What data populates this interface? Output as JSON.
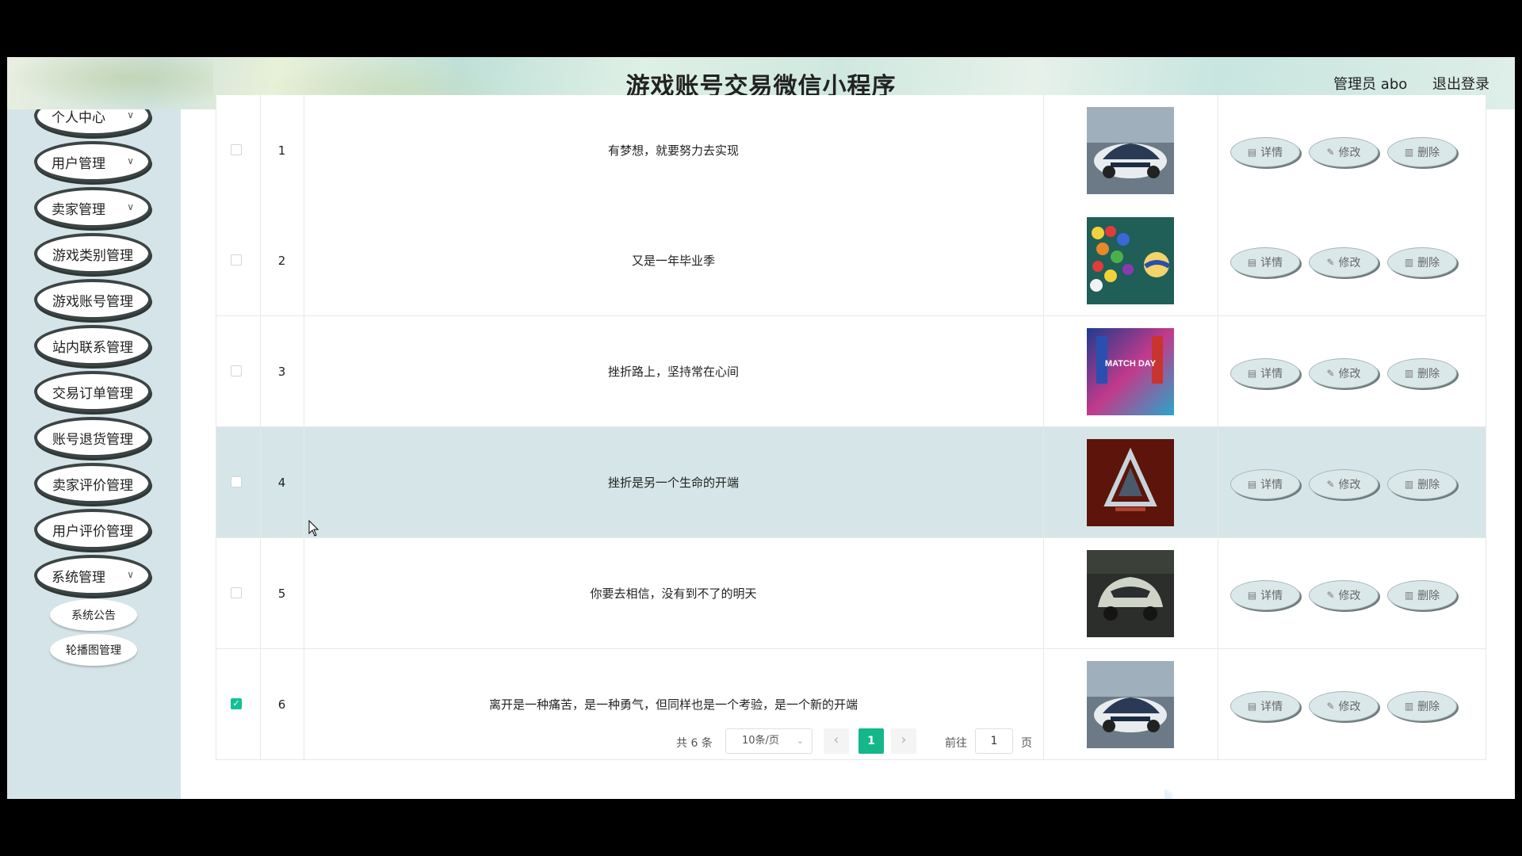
{
  "header": {
    "title": "游戏账号交易微信小程序",
    "user": "管理员 abo",
    "logout": "退出登录"
  },
  "sidebar": {
    "items": [
      {
        "label": "个人中心",
        "has_sub": true
      },
      {
        "label": "用户管理",
        "has_sub": true
      },
      {
        "label": "卖家管理",
        "has_sub": true
      },
      {
        "label": "游戏类别管理",
        "has_sub": false
      },
      {
        "label": "游戏账号管理",
        "has_sub": false
      },
      {
        "label": "站内联系管理",
        "has_sub": false
      },
      {
        "label": "交易订单管理",
        "has_sub": false
      },
      {
        "label": "账号退货管理",
        "has_sub": false
      },
      {
        "label": "卖家评价管理",
        "has_sub": false
      },
      {
        "label": "用户评价管理",
        "has_sub": false
      },
      {
        "label": "系统管理",
        "has_sub": true
      }
    ],
    "subitems": [
      {
        "label": "系统公告"
      },
      {
        "label": "轮播图管理"
      }
    ]
  },
  "table": {
    "rows": [
      {
        "index": "1",
        "text": "有梦想，就要努力去实现",
        "checked": false,
        "highlight": false,
        "thumb": "car-police"
      },
      {
        "index": "2",
        "text": "又是一年毕业季",
        "checked": false,
        "highlight": false,
        "thumb": "billiard-balls"
      },
      {
        "index": "3",
        "text": "挫折路上，坚持常在心间",
        "checked": false,
        "highlight": false,
        "thumb": "match-day-poster"
      },
      {
        "index": "4",
        "text": "挫折是另一个生命的开端",
        "checked": false,
        "highlight": true,
        "thumb": "red-logo"
      },
      {
        "index": "5",
        "text": "你要去相信，没有到不了的明天",
        "checked": false,
        "highlight": false,
        "thumb": "car-silver"
      },
      {
        "index": "6",
        "text": "离开是一种痛苦，是一种勇气，但同样也是一个考验，是一个新的开端",
        "checked": true,
        "highlight": false,
        "thumb": "car-police"
      }
    ],
    "actions": {
      "detail": "详情",
      "edit": "修改",
      "delete": "删除"
    },
    "thumb_text": {
      "match_day": "MATCH DAY"
    }
  },
  "pagination": {
    "total": "共 6 条",
    "page_size": "10条/页",
    "current": "1",
    "goto_label": "前往",
    "goto_value": "1",
    "page_unit": "页"
  }
}
